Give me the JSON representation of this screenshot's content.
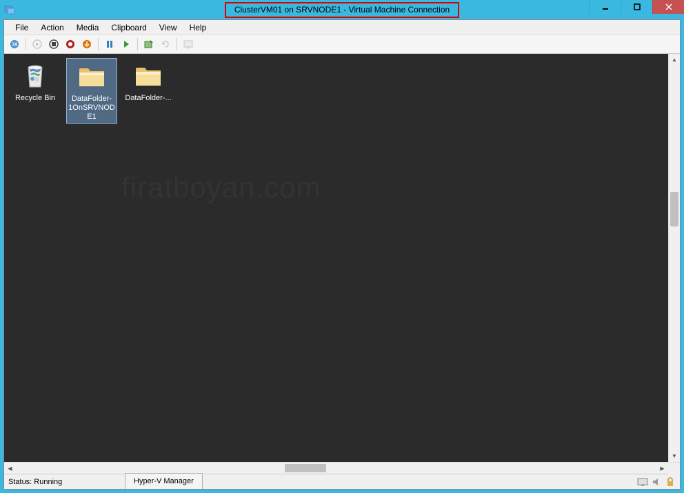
{
  "title": "ClusterVM01 on SRVNODE1 - Virtual Machine Connection",
  "menu": [
    "File",
    "Action",
    "Media",
    "Clipboard",
    "View",
    "Help"
  ],
  "desktop_icons": [
    {
      "name": "Recycle Bin",
      "type": "recycle",
      "selected": false
    },
    {
      "name": "DataFolder-1OnSRVNODE1",
      "type": "folder",
      "selected": true
    },
    {
      "name": "DataFolder-...",
      "type": "folder",
      "selected": false
    }
  ],
  "status": "Status: Running",
  "taskbar_tab": "Hyper-V Manager",
  "watermark": "firatboyan.com"
}
